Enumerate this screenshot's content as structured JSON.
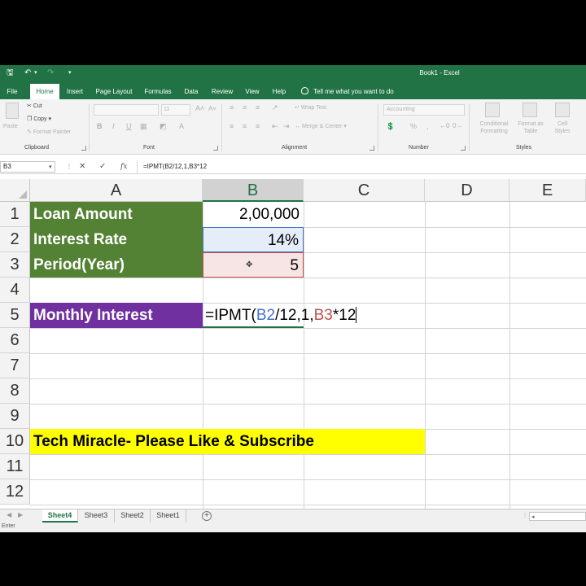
{
  "window": {
    "title": "Book1 - Excel",
    "save_icon": "save-icon",
    "undo_icon": "undo-icon",
    "redo_icon": "redo-icon"
  },
  "ribbon_tabs": [
    "File",
    "Home",
    "Insert",
    "Page Layout",
    "Formulas",
    "Data",
    "Review",
    "View",
    "Help"
  ],
  "active_tab": "Home",
  "tell_me": "Tell me what you want to do",
  "ribbon": {
    "clipboard": {
      "label": "Clipboard",
      "paste": "Paste",
      "cut": "Cut",
      "copy": "Copy",
      "format_painter": "Format Painter"
    },
    "font": {
      "label": "Font",
      "font_size": "11",
      "bold": "B",
      "italic": "I",
      "underline": "U"
    },
    "alignment": {
      "label": "Alignment",
      "wrap_text": "Wrap Text",
      "merge_center": "Merge & Center"
    },
    "number": {
      "label": "Number",
      "format": "Accounting",
      "percent": "%",
      "comma": ","
    },
    "styles": {
      "label": "Styles",
      "conditional_formatting": [
        "Conditional",
        "Formatting"
      ],
      "format_as_table": [
        "Format as",
        "Table"
      ],
      "cell_styles": [
        "Cell",
        "Styles"
      ]
    }
  },
  "formula_bar": {
    "name_box": "B3",
    "cancel": "✕",
    "enter": "✓",
    "fx": "fx",
    "formula": "=IPMT(B2/12,1,B3*12"
  },
  "columns": [
    "A",
    "B",
    "C",
    "D",
    "E"
  ],
  "selected_column": "B",
  "rows": [
    "1",
    "2",
    "3",
    "4",
    "5",
    "6",
    "7",
    "8",
    "9",
    "10",
    "11",
    "12"
  ],
  "cells": {
    "A1": "Loan Amount",
    "B1": "2,00,000",
    "A2": "Interest Rate",
    "B2": "14%",
    "A3": "Period(Year)",
    "B3": "5",
    "A5": "Monthly Interest",
    "B5_parts": [
      "=IPMT(",
      "B2",
      "/12,1,",
      "B3",
      "*12"
    ],
    "A10": "Tech Miracle- Please Like & Subscribe"
  },
  "colors": {
    "excel_green": "#217346",
    "label_green": "#548235",
    "label_purple": "#7030a0",
    "highlight_yellow": "#ffff00",
    "ref_blue": "#4472c4",
    "ref_red": "#c0504d"
  },
  "sheets": [
    "Sheet4",
    "Sheet3",
    "Sheet2",
    "Sheet1"
  ],
  "active_sheet": "Sheet4",
  "status": "Enter"
}
